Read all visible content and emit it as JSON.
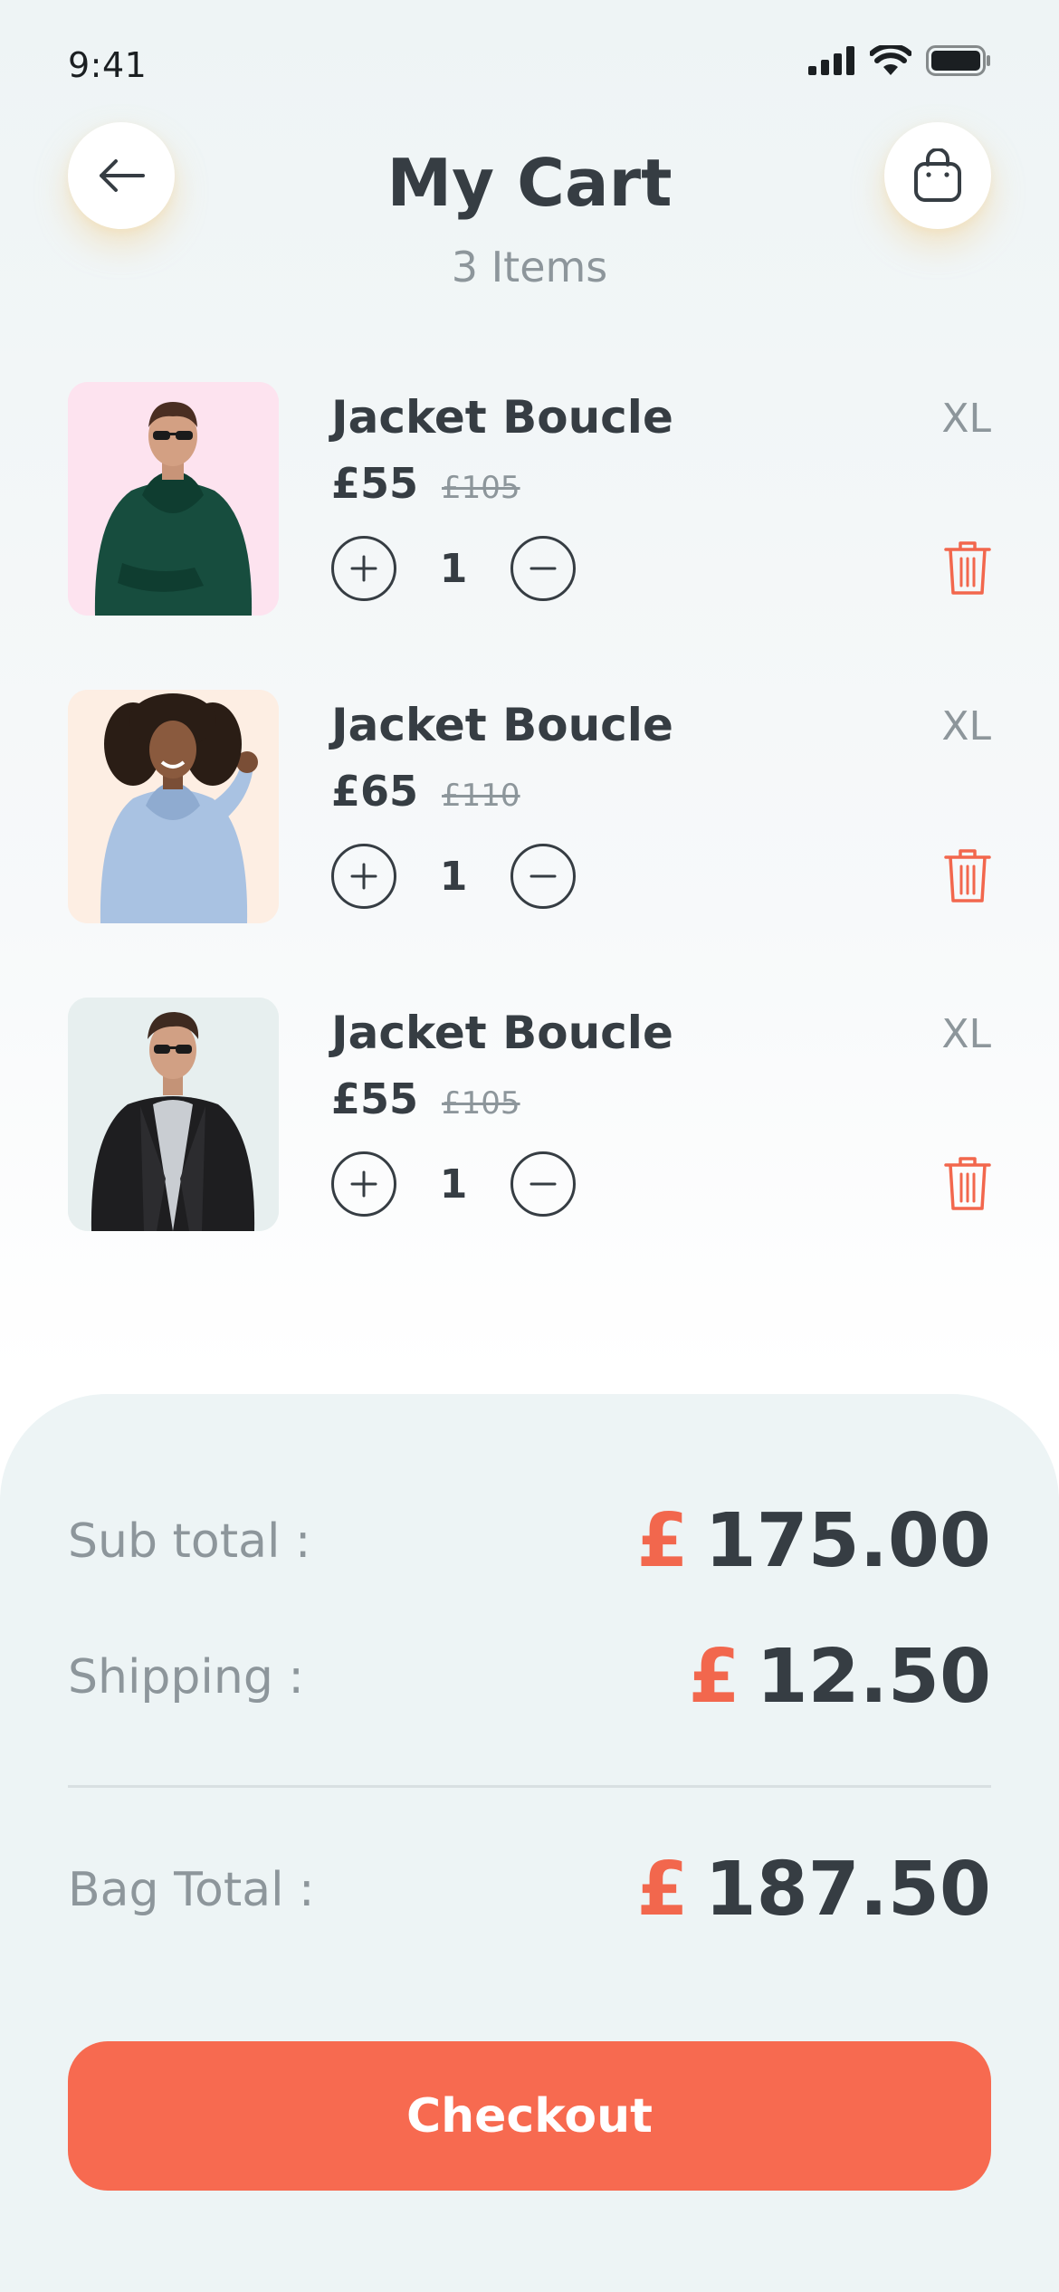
{
  "status_bar": {
    "time": "9:41"
  },
  "header": {
    "title": "My Cart",
    "item_count": "3 Items",
    "back_icon": "arrow-left-icon",
    "bag_icon": "shopping-bag-icon"
  },
  "cart": {
    "items": [
      {
        "name": "Jacket Boucle",
        "size": "XL",
        "price": "£55",
        "old_price": "£105",
        "quantity": "1",
        "thumb_bg": "#fde3ef"
      },
      {
        "name": "Jacket Boucle",
        "size": "XL",
        "price": "£65",
        "old_price": "£110",
        "quantity": "1",
        "thumb_bg": "#fdeee3"
      },
      {
        "name": "Jacket Boucle",
        "size": "XL",
        "price": "£55",
        "old_price": "£105",
        "quantity": "1",
        "thumb_bg": "#e7efef"
      }
    ]
  },
  "summary": {
    "subtotal_label": "Sub total :",
    "subtotal_value": "175.00",
    "shipping_label": "Shipping :",
    "shipping_value": "12.50",
    "bag_total_label": "Bag Total :",
    "bag_total_value": "187.50",
    "currency": "£"
  },
  "checkout": {
    "label": "Checkout"
  },
  "colors": {
    "accent": "#f76a50",
    "text_dark": "#363d43",
    "text_muted": "#8d969b"
  }
}
